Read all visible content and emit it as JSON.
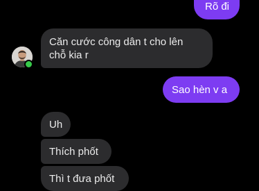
{
  "conversation": {
    "messages": [
      {
        "direction": "outgoing",
        "text": "Rõ đi"
      },
      {
        "direction": "incoming",
        "line1": "Căn cước công dân t cho lên",
        "line2": "chỗ kia r"
      },
      {
        "direction": "outgoing",
        "text": "Sao hèn v a"
      },
      {
        "direction": "incoming",
        "text": "Uh"
      },
      {
        "direction": "incoming",
        "text": "Thích phốt"
      },
      {
        "direction": "incoming",
        "text": "Thì t đưa phốt"
      }
    ],
    "contact": {
      "avatar": "contact-avatar",
      "status": "online"
    }
  },
  "colors": {
    "background": "#000000",
    "outgoing_bubble": "#7d3cf2",
    "incoming_bubble": "#2c2c2e",
    "online_indicator": "#37c94a"
  }
}
